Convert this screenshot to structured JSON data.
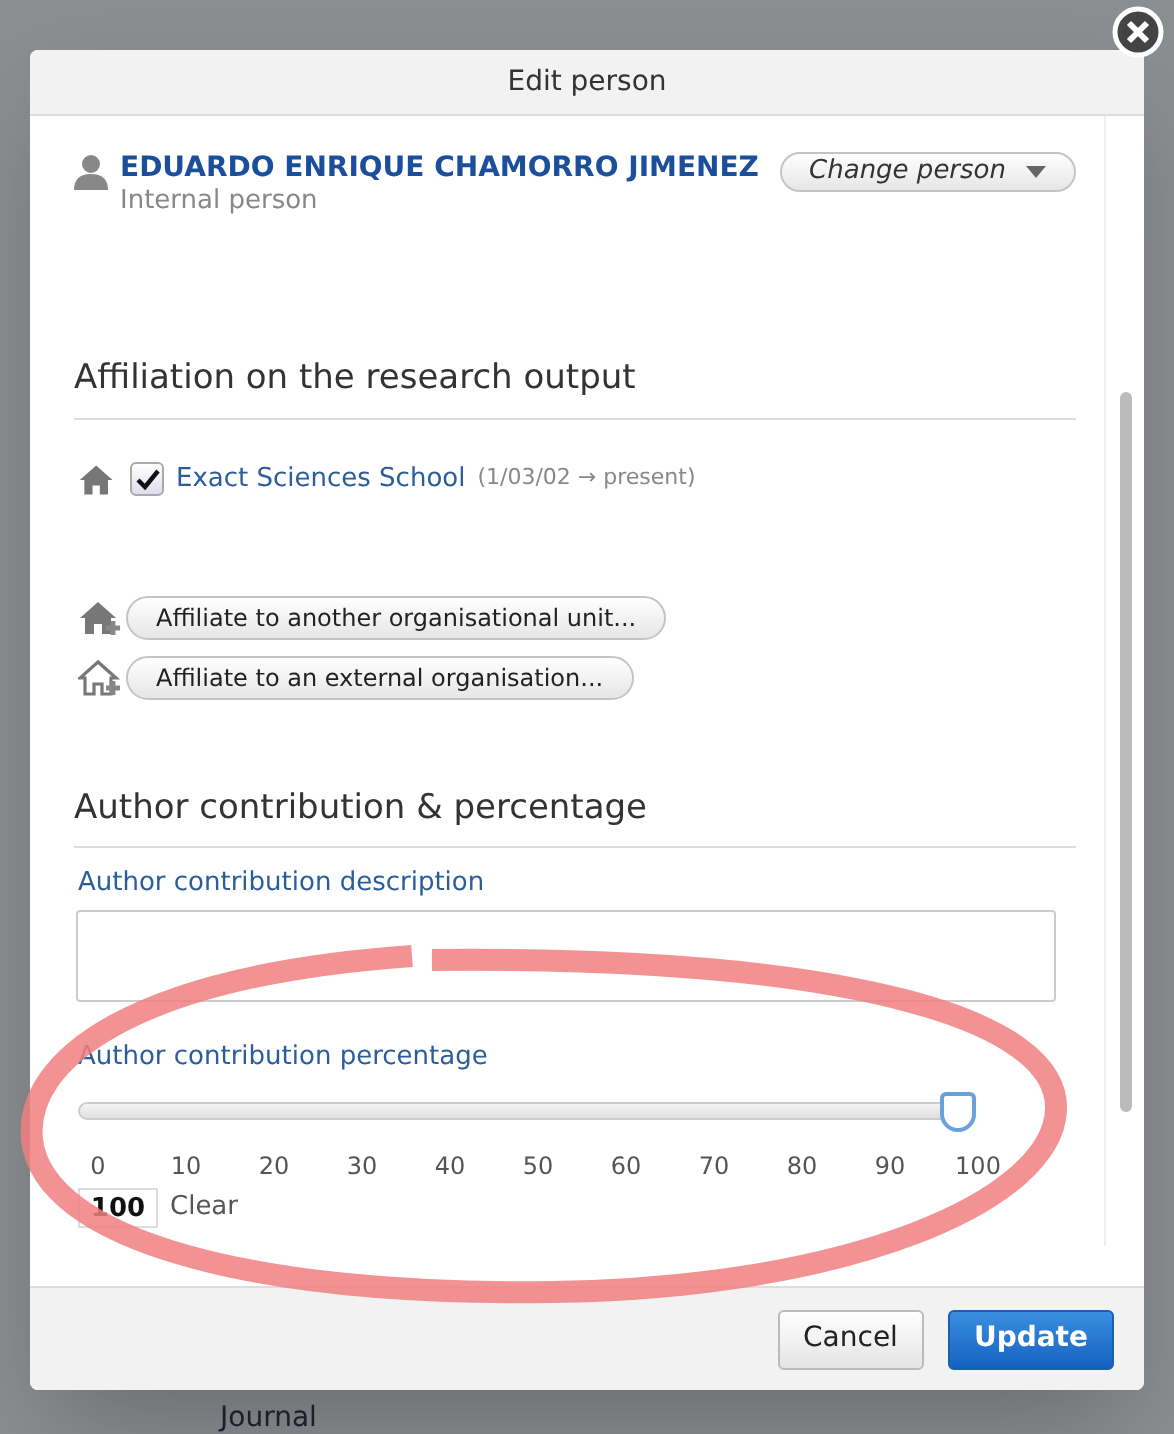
{
  "dialog": {
    "title": "Edit person"
  },
  "person": {
    "name": "EDUARDO ENRIQUE CHAMORRO JIMENEZ",
    "type": "Internal person",
    "change_button": "Change person"
  },
  "affiliation": {
    "heading": "Affiliation on the research output",
    "units": [
      {
        "name": "Exact Sciences School",
        "period": "(1/03/02 → present)",
        "checked": true
      }
    ],
    "buttons": [
      {
        "kind": "internal",
        "label": "Affiliate to another organisational unit..."
      },
      {
        "kind": "external",
        "label": "Affiliate to an external organisation..."
      }
    ]
  },
  "contribution": {
    "heading": "Author contribution & percentage",
    "description_label": "Author contribution description",
    "percentage_label": "Author contribution percentage",
    "level": 1.0,
    "ticks": [
      "0",
      "10",
      "20",
      "30",
      "40",
      "50",
      "60",
      "70",
      "80",
      "90",
      "100"
    ],
    "value": "100",
    "clear": "Clear"
  },
  "footer": {
    "buttons": [
      {
        "label": "Cancel",
        "primary": false
      },
      {
        "label": "Update",
        "primary": true
      }
    ]
  },
  "background": {
    "text": "Journal"
  }
}
